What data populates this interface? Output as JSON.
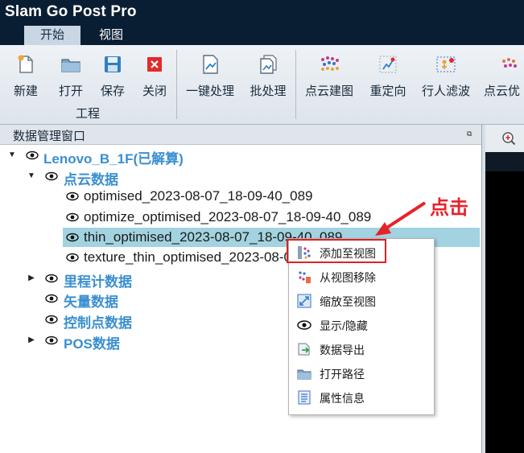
{
  "app": {
    "title": "Slam Go Post Pro"
  },
  "menu": {
    "tabs": [
      "开始",
      "视图"
    ],
    "active": 0
  },
  "ribbon": {
    "project_group": {
      "label": "工程",
      "buttons": [
        "新建",
        "打开",
        "保存",
        "关闭"
      ]
    },
    "process_buttons": [
      "一键处理",
      "批处理",
      "点云建图",
      "重定向",
      "行人滤波",
      "点云优"
    ]
  },
  "panel": {
    "title": "数据管理窗口"
  },
  "tree": {
    "root": "Lenovo_B_1F(已解算)",
    "pointcloud_group": "点云数据",
    "pointclouds": [
      "optimised_2023-08-07_18-09-40_089",
      "optimize_optimised_2023-08-07_18-09-40_089",
      "thin_optimised_2023-08-07_18-09-40_089",
      "texture_thin_optimised_2023-08-07_18-09-40_089"
    ],
    "odometry_group": "里程计数据",
    "vector_group": "矢量数据",
    "control_group": "控制点数据",
    "pos_group": "POS数据"
  },
  "context_menu": {
    "items": [
      "添加至视图",
      "从视图移除",
      "缩放至视图",
      "显示/隐藏",
      "数据导出",
      "打开路径",
      "属性信息"
    ],
    "highlighted": 0
  },
  "annotation": {
    "text": "点击",
    "color": "#e8222a"
  },
  "colors": {
    "titlebar": "#0a1e33",
    "tree_accent": "#3a8fd0",
    "selection": "#a3d3e0"
  }
}
